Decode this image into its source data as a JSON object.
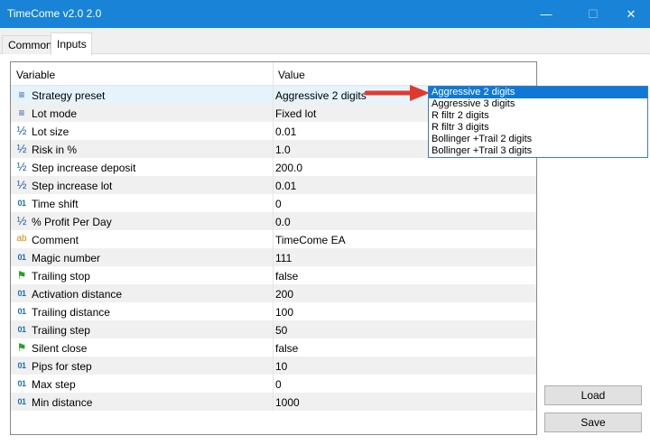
{
  "window": {
    "title": "TimeCome v2.0 2.0",
    "minimize_glyph": "—",
    "maximize_glyph": "☐",
    "close_glyph": "✕"
  },
  "tabs": [
    {
      "label": "Common",
      "active": false
    },
    {
      "label": "Inputs",
      "active": true
    }
  ],
  "grid": {
    "headers": {
      "variable": "Variable",
      "value": "Value"
    },
    "rows": [
      {
        "icon": "list-icon",
        "glyph": "≡",
        "name": "Strategy preset",
        "value": "Aggressive 2 digits"
      },
      {
        "icon": "list-icon",
        "glyph": "≡",
        "name": "Lot mode",
        "value": "Fixed lot"
      },
      {
        "icon": "double-icon",
        "glyph": "½",
        "name": "Lot size",
        "value": "0.01"
      },
      {
        "icon": "double-icon",
        "glyph": "½",
        "name": "Risk in %",
        "value": "1.0"
      },
      {
        "icon": "double-icon",
        "glyph": "½",
        "name": "Step increase deposit",
        "value": "200.0"
      },
      {
        "icon": "double-icon",
        "glyph": "½",
        "name": "Step increase lot",
        "value": "0.01"
      },
      {
        "icon": "integer-icon",
        "glyph": "01",
        "name": "Time shift",
        "value": "0"
      },
      {
        "icon": "double-icon",
        "glyph": "½",
        "name": "% Profit Per Day",
        "value": "0.0"
      },
      {
        "icon": "string-icon",
        "glyph": "ab",
        "name": "Comment",
        "value": "TimeCome EA"
      },
      {
        "icon": "integer-icon",
        "glyph": "01",
        "name": "Magic number",
        "value": "111"
      },
      {
        "icon": "boolean-icon",
        "glyph": "⚑",
        "name": "Trailing stop",
        "value": "false"
      },
      {
        "icon": "integer-icon",
        "glyph": "01",
        "name": "Activation distance",
        "value": "200"
      },
      {
        "icon": "integer-icon",
        "glyph": "01",
        "name": "Trailing distance",
        "value": "100"
      },
      {
        "icon": "integer-icon",
        "glyph": "01",
        "name": "Trailing step",
        "value": "50"
      },
      {
        "icon": "boolean-icon",
        "glyph": "⚑",
        "name": "Silent close",
        "value": "false"
      },
      {
        "icon": "integer-icon",
        "glyph": "01",
        "name": "Pips for step",
        "value": "10"
      },
      {
        "icon": "integer-icon",
        "glyph": "01",
        "name": "Max step",
        "value": "0"
      },
      {
        "icon": "integer-icon",
        "glyph": "01",
        "name": "Min distance",
        "value": "1000"
      }
    ]
  },
  "dropdown": {
    "options": [
      "Aggressive 2 digits",
      "Aggressive 3 digits",
      "R filtr 2 digits",
      "R filtr 3 digits",
      "Bollinger +Trail 2 digits",
      "Bollinger +Trail 3 digits"
    ],
    "selected": "Aggressive 2 digits"
  },
  "buttons": {
    "load": "Load",
    "save": "Save"
  },
  "colors": {
    "titlebar": "#1883d7",
    "selection": "#0f78d7",
    "arrow": "#e03a2e"
  }
}
